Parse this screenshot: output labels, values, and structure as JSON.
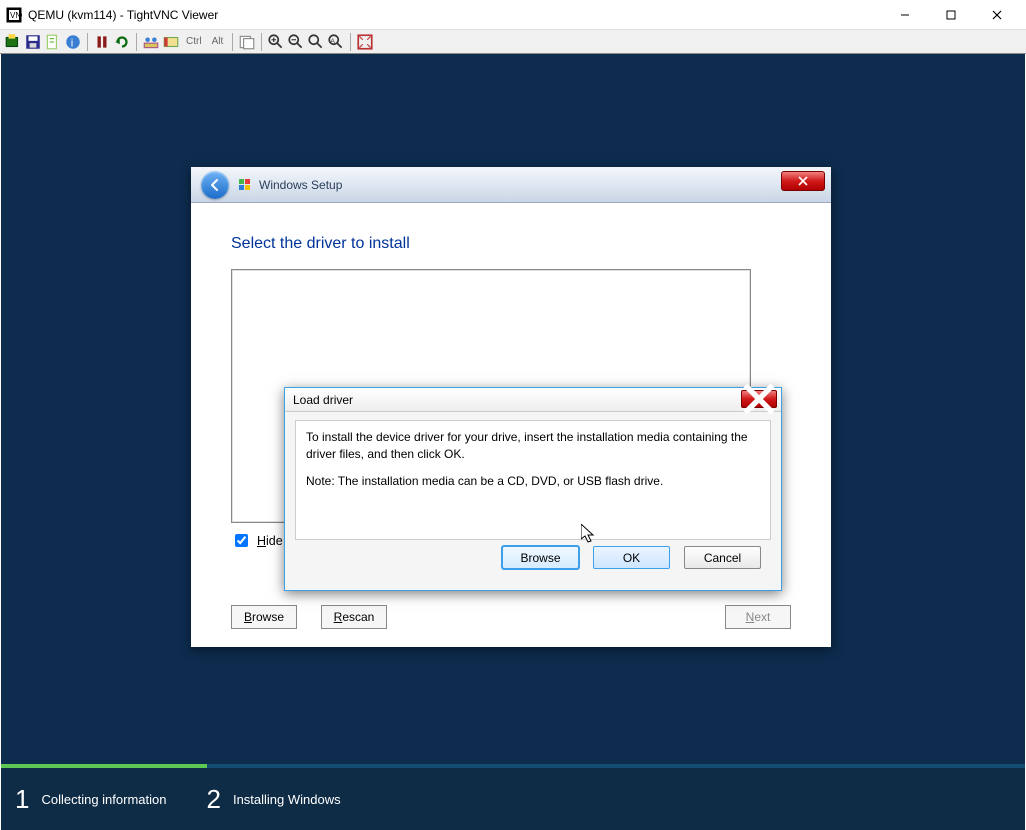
{
  "vnc": {
    "title": "QEMU (kvm114) - TightVNC Viewer",
    "toolbar_keys": {
      "ctrl": "Ctrl",
      "alt": "Alt"
    }
  },
  "wizard": {
    "title": "Windows Setup",
    "page_title": "Select the driver to install",
    "hide_label": "Hide drivers that aren't compatible with this computer's hardware.",
    "buttons": {
      "browse": "Browse",
      "rescan": "Rescan",
      "next": "Next"
    }
  },
  "modal": {
    "title": "Load driver",
    "line1": "To install the device driver for your drive, insert the installation media containing the driver files, and then click OK.",
    "line2": "Note: The installation media can be a CD, DVD, or USB flash drive.",
    "buttons": {
      "browse": "Browse",
      "ok": "OK",
      "cancel": "Cancel"
    }
  },
  "progress": {
    "step1": "Collecting information",
    "step2": "Installing Windows"
  }
}
